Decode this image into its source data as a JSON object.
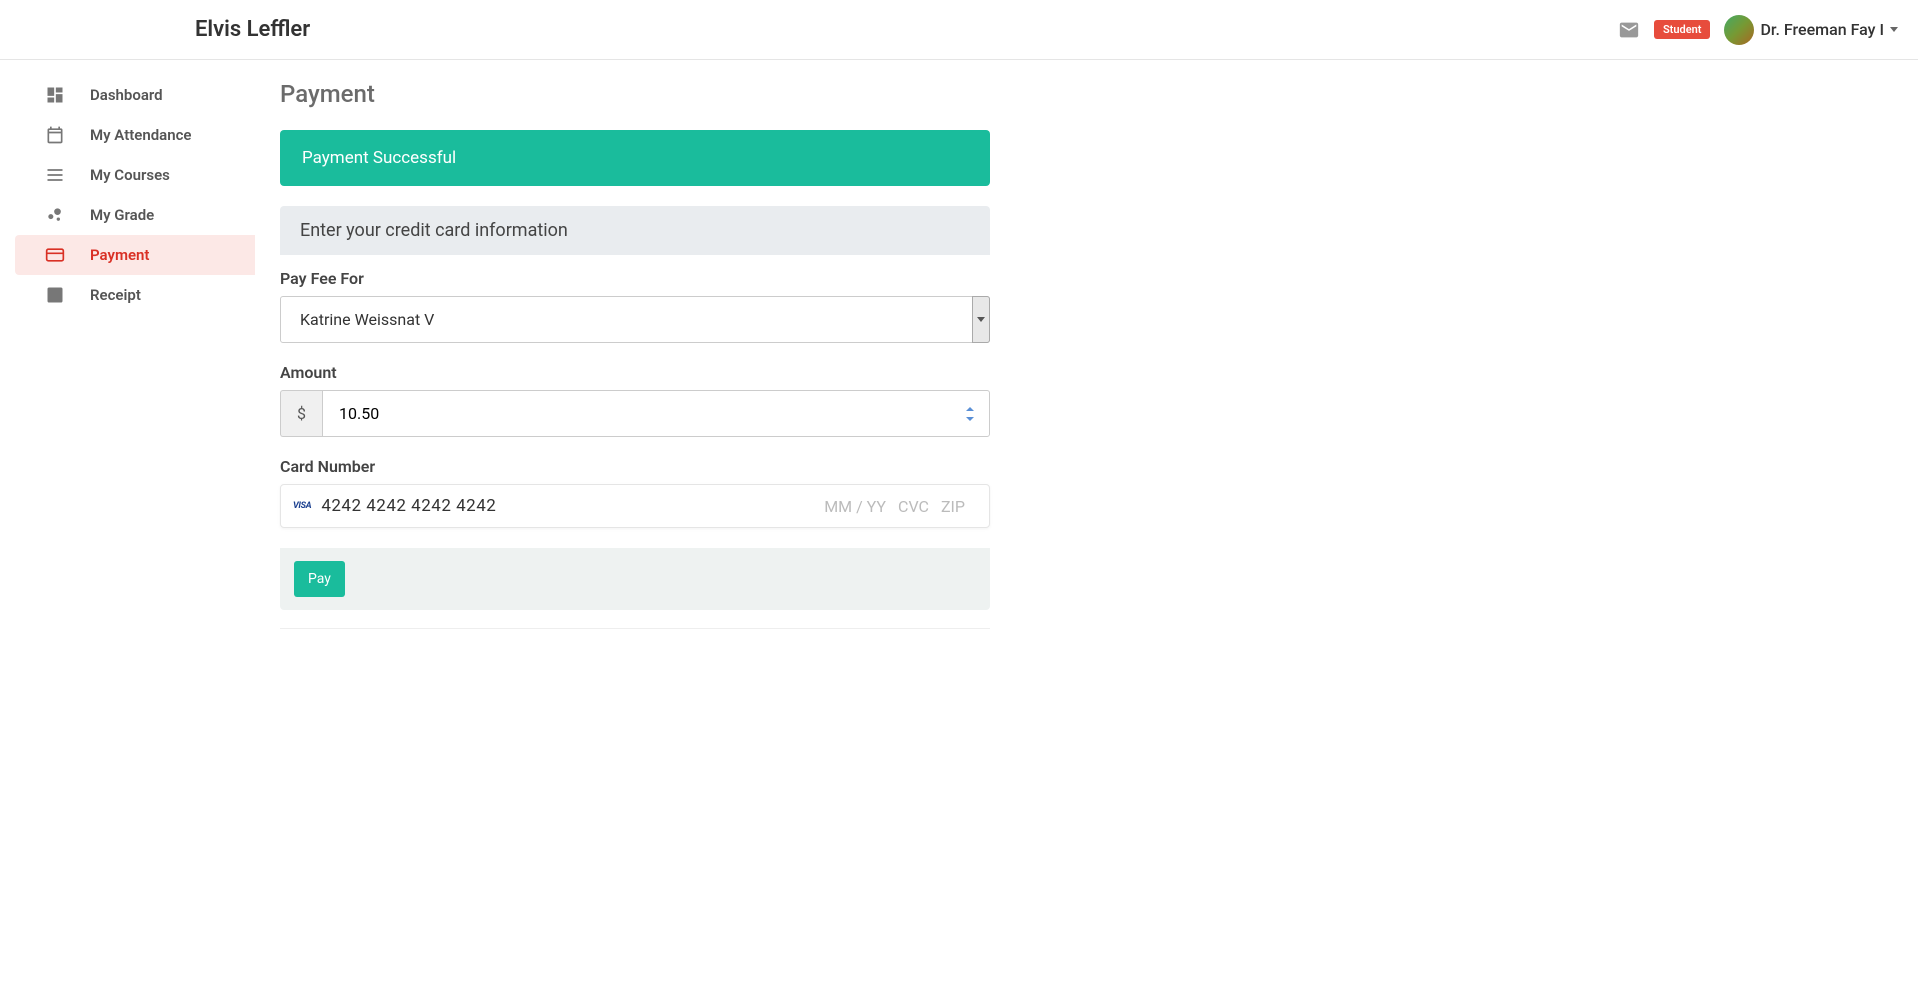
{
  "header": {
    "title": "Elvis Leffler",
    "role_badge": "Student",
    "user_name": "Dr. Freeman Fay I"
  },
  "sidebar": {
    "items": [
      {
        "label": "Dashboard",
        "icon": "dashboard-icon"
      },
      {
        "label": "My Attendance",
        "icon": "calendar-icon"
      },
      {
        "label": "My Courses",
        "icon": "list-icon"
      },
      {
        "label": "My Grade",
        "icon": "bubble-chart-icon"
      },
      {
        "label": "Payment",
        "icon": "credit-card-icon"
      },
      {
        "label": "Receipt",
        "icon": "receipt-icon"
      }
    ]
  },
  "main": {
    "page_title": "Payment",
    "alert": "Payment Successful",
    "panel_heading": "Enter your credit card information",
    "pay_for_label": "Pay Fee For",
    "pay_for_value": "Katrine Weissnat V",
    "amount_label": "Amount",
    "amount_currency": "$",
    "amount_value": "10.50",
    "card_label": "Card Number",
    "card_brand": "VISA",
    "card_number": "4242 4242 4242 4242",
    "card_exp_placeholder": "MM / YY",
    "card_cvc_placeholder": "CVC",
    "card_zip_placeholder": "ZIP",
    "pay_button": "Pay"
  }
}
